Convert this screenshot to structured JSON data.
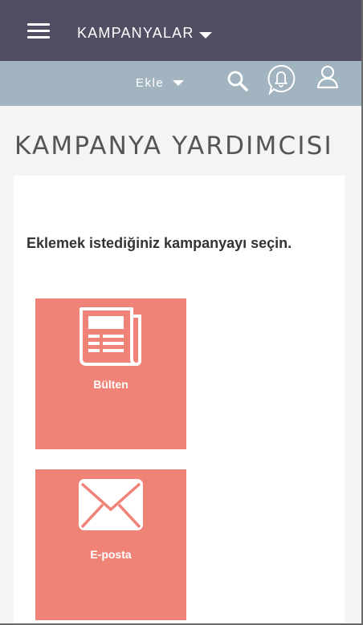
{
  "header": {
    "module_label": "KAMPANYALAR",
    "menu_icon": "hamburger-menu-icon",
    "dropdown_icon": "caret-down-icon"
  },
  "subheader": {
    "add_label": "Ekle",
    "icons": [
      "search-icon",
      "bell-icon",
      "user-icon"
    ]
  },
  "page": {
    "title": "KAMPANYA YARDIMCISI",
    "instruction": "Eklemek istediğiniz kampanyayı seçin."
  },
  "campaign_types": [
    {
      "label": "Bülten",
      "icon": "newspaper-icon"
    },
    {
      "label": "E-posta",
      "icon": "envelope-icon"
    }
  ],
  "colors": {
    "topbar": "#534d64",
    "subbar": "#a2b4c0",
    "tile": "#f08377",
    "background": "#f4f4f4"
  }
}
